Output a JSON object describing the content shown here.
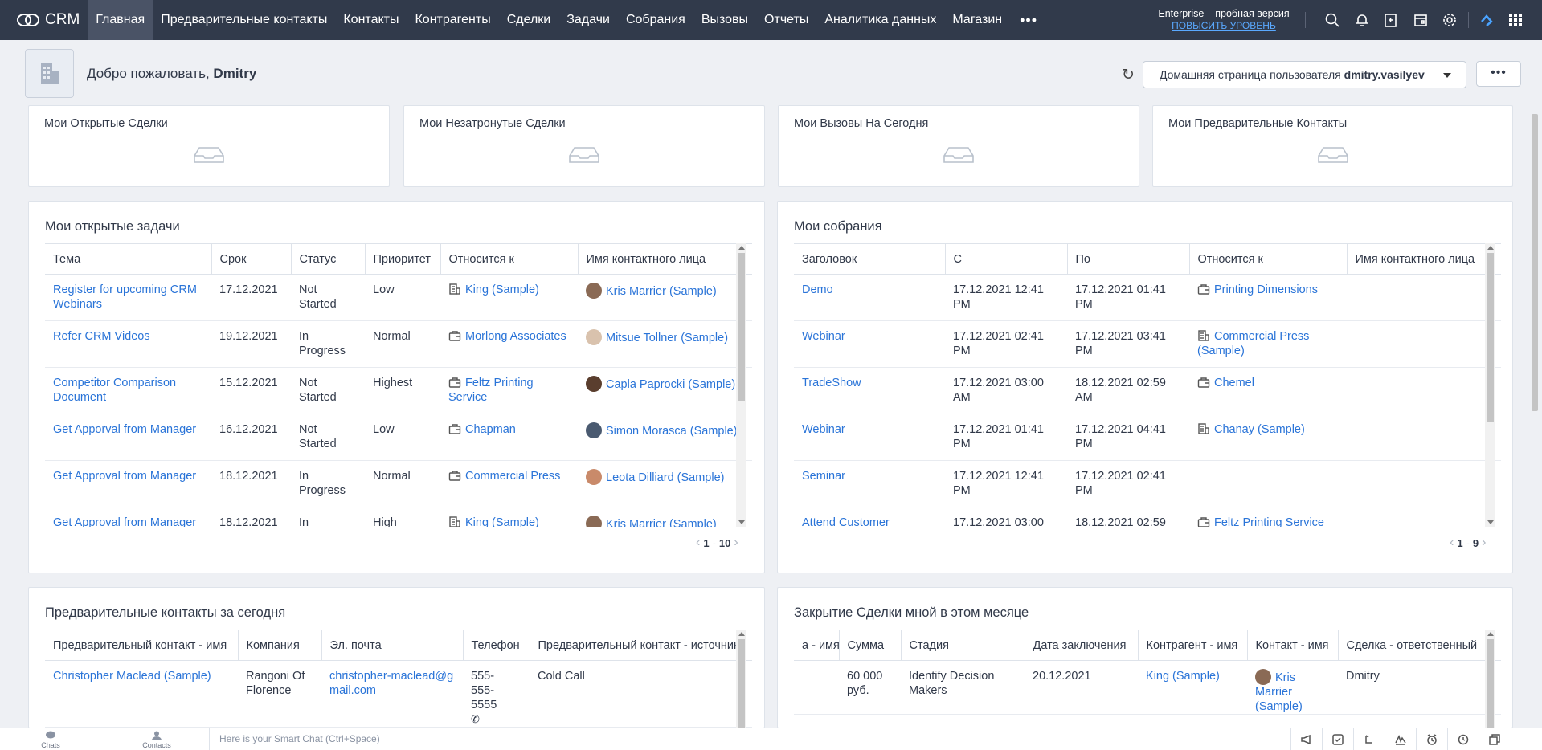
{
  "app": {
    "name": "CRM"
  },
  "nav": [
    {
      "label": "Главная",
      "active": true
    },
    {
      "label": "Предварительные контакты"
    },
    {
      "label": "Контакты"
    },
    {
      "label": "Контрагенты"
    },
    {
      "label": "Сделки"
    },
    {
      "label": "Задачи"
    },
    {
      "label": "Собрания"
    },
    {
      "label": "Вызовы"
    },
    {
      "label": "Отчеты"
    },
    {
      "label": "Аналитика данных"
    },
    {
      "label": "Магазин"
    }
  ],
  "nav_more": "•••",
  "edition": {
    "text": "Enterprise – пробная версия",
    "upgrade": "ПОВЫСИТЬ УРОВЕНЬ"
  },
  "top_icons": [
    "search-icon",
    "bell-icon",
    "add-note-icon",
    "calendar-icon",
    "gear-icon",
    "cloud-sync-icon",
    "apps-grid-icon"
  ],
  "welcome": {
    "prefix": "Добро пожаловать,",
    "user": "Dmitry"
  },
  "home_select": {
    "prefix": "Домашняя страница пользователя",
    "user": "dmitry.vasilyev"
  },
  "more_btn": "•••",
  "kpis": [
    {
      "title": "Мои Открытые Сделки"
    },
    {
      "title": "Мои Незатронутые Сделки"
    },
    {
      "title": "Мои Вызовы На Сегодня"
    },
    {
      "title": "Мои Предварительные Контакты"
    }
  ],
  "tasks": {
    "title": "Мои открытые задачи",
    "columns": [
      "Тема",
      "Срок",
      "Статус",
      "Приоритет",
      "Относится к",
      "Имя контактного лица"
    ],
    "rows": [
      {
        "subject": "Register for upcoming CRM Webinars",
        "due": "17.12.2021",
        "status": "Not Started",
        "priority": "Low",
        "related": "King (Sample)",
        "related_icon": "building-icon",
        "contact": "Kris Marrier (Sample)",
        "pic": "#8a6a55"
      },
      {
        "subject": "Refer CRM Videos",
        "due": "19.12.2021",
        "status": "In Progress",
        "priority": "Normal",
        "related": "Morlong Associates",
        "related_icon": "briefcase-icon",
        "contact": "Mitsue Tollner (Sample)",
        "pic": "#d9c2ad"
      },
      {
        "subject": "Competitor Comparison Document",
        "due": "15.12.2021",
        "status": "Not Started",
        "priority": "Highest",
        "related": "Feltz Printing Service",
        "related_icon": "briefcase-icon",
        "contact": "Capla Paprocki (Sample)",
        "pic": "#5a3e2e"
      },
      {
        "subject": "Get Apporval from Manager",
        "due": "16.12.2021",
        "status": "Not Started",
        "priority": "Low",
        "related": "Chapman",
        "related_icon": "briefcase-icon",
        "contact": "Simon Morasca (Sample)",
        "pic": "#4a5a70"
      },
      {
        "subject": "Get Approval from Manager",
        "due": "18.12.2021",
        "status": "In Progress",
        "priority": "Normal",
        "related": "Commercial Press",
        "related_icon": "briefcase-icon",
        "contact": "Leota Dilliard (Sample)",
        "pic": "#c98a6a"
      },
      {
        "subject": "Get Approval from Manager",
        "due": "18.12.2021",
        "status": "In",
        "priority": "High",
        "related": "King (Sample)",
        "related_icon": "building-icon",
        "contact": "Kris Marrier (Sample)",
        "pic": "#8a6a55"
      }
    ],
    "pager": {
      "from": "1",
      "to": "10"
    }
  },
  "meetings": {
    "title": "Мои собрания",
    "columns": [
      "Заголовок",
      "С",
      "По",
      "Относится к",
      "Имя контактного лица"
    ],
    "rows": [
      {
        "title": "Demo",
        "from": "17.12.2021 12:41 PM",
        "to": "17.12.2021 01:41 PM",
        "related": "Printing Dimensions",
        "related_icon": "briefcase-icon",
        "contact": ""
      },
      {
        "title": "Webinar",
        "from": "17.12.2021 02:41 PM",
        "to": "17.12.2021 03:41 PM",
        "related": "Commercial Press (Sample)",
        "related_icon": "building-icon",
        "contact": ""
      },
      {
        "title": "TradeShow",
        "from": "17.12.2021 03:00 AM",
        "to": "18.12.2021 02:59 AM",
        "related": "Chemel",
        "related_icon": "briefcase-icon",
        "contact": ""
      },
      {
        "title": "Webinar",
        "from": "17.12.2021 01:41 PM",
        "to": "17.12.2021 04:41 PM",
        "related": "Chanay (Sample)",
        "related_icon": "building-icon",
        "contact": ""
      },
      {
        "title": "Seminar",
        "from": "17.12.2021 12:41 PM",
        "to": "17.12.2021 02:41 PM",
        "related": "",
        "related_icon": "",
        "contact": ""
      },
      {
        "title": "Attend Customer",
        "from": "17.12.2021 03:00",
        "to": "18.12.2021 02:59",
        "related": "Feltz Printing Service",
        "related_icon": "briefcase-icon",
        "contact": ""
      }
    ],
    "pager": {
      "from": "1",
      "to": "9"
    }
  },
  "leads_today": {
    "title": "Предварительные контакты за сегодня",
    "columns": [
      "Предварительный контакт - имя",
      "Компания",
      "Эл. почта",
      "Телефон",
      "Предварительный контакт - источник"
    ],
    "rows": [
      {
        "name": "Christopher Maclead (Sample)",
        "company": "Rangoni Of Florence",
        "email": "christopher-maclead@gmail.com",
        "phone": "555-555-5555",
        "source": "Cold Call"
      }
    ]
  },
  "deals_closing": {
    "title": "Закрытие Сделки мной в этом месяце",
    "columns": [
      "а - имя",
      "Сумма",
      "Стадия",
      "Дата заключения",
      "Контрагент - имя",
      "Контакт - имя",
      "Сделка - ответственный"
    ],
    "rows": [
      {
        "name": "",
        "amount": "60 000 руб.",
        "stage": "Identify Decision Makers",
        "closing": "20.12.2021",
        "account": "King (Sample)",
        "contact": "Kris Marrier (Sample)",
        "owner": "Dmitry",
        "pic": "#8a6a55"
      }
    ]
  },
  "bottom": {
    "chats": "Chats",
    "contacts": "Contacts",
    "smartchat_placeholder": "Here is your Smart Chat (Ctrl+Space)",
    "icons": [
      "megaphone-icon",
      "checklist-icon",
      "redo-icon",
      "signature-icon",
      "alarm-icon",
      "history-icon",
      "multi-window-icon"
    ]
  }
}
